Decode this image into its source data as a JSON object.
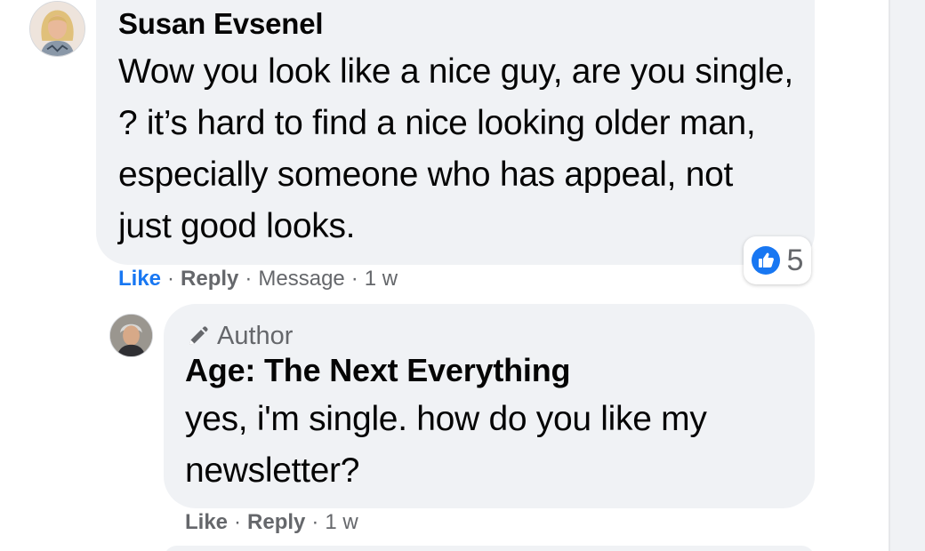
{
  "colors": {
    "bubble": "#f0f2f5",
    "secondary_text": "#65676b",
    "like_blue": "#1877f2"
  },
  "comment": {
    "author": "Susan Evsenel",
    "text": "Wow you look like a nice guy, are you single, ? it’s hard to find a nice looking older man, especially someone who has appeal, not just good looks.",
    "actions": {
      "like": "Like",
      "reply": "Reply",
      "message": "Message",
      "time": "1 w"
    },
    "reaction": {
      "icon": "thumbs-up-icon",
      "count": "5"
    }
  },
  "reply": {
    "badge": "Author",
    "badge_icon": "pencil-icon",
    "author": "Age: The Next Everything",
    "text": "yes, i'm single. how do you like my newsletter?",
    "actions": {
      "like": "Like",
      "reply": "Reply",
      "time": "1 w"
    }
  },
  "separator": "·"
}
